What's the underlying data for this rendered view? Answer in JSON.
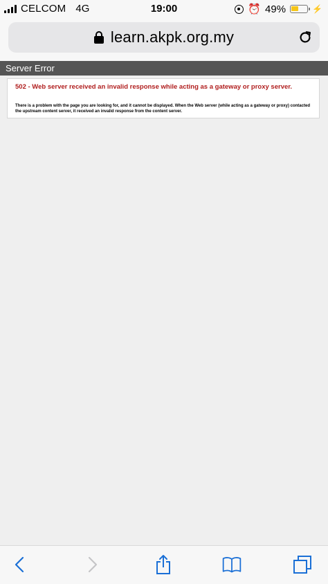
{
  "status_bar": {
    "carrier": "CELCOM",
    "network": "4G",
    "time": "19:00",
    "battery_percent": "49%",
    "battery_level": 0.49,
    "battery_color": "#f5c518"
  },
  "address_bar": {
    "url": "learn.akpk.org.my",
    "lock_icon": "lock-icon",
    "reload_icon": "reload-icon"
  },
  "page": {
    "header_title": "Server Error",
    "header_bg": "#555555",
    "error_title": "502 - Web server received an invalid response while acting as a gateway or proxy server.",
    "error_title_color": "#b01d1d",
    "error_description": "There is a problem with the page you are looking for, and it cannot be displayed. When the Web server (while acting as a gateway or proxy) contacted the upstream content server, it received an invalid response from the content server."
  },
  "toolbar": {
    "icons": [
      "back-icon",
      "forward-icon",
      "share-icon",
      "bookmarks-icon",
      "tabs-icon"
    ],
    "accent": "#1a6fd6"
  }
}
